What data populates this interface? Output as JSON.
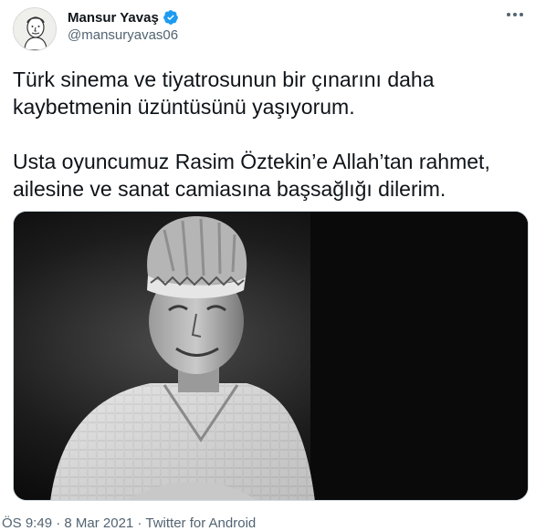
{
  "author": {
    "display_name": "Mansur Yavaş",
    "handle": "@mansuryavas06",
    "verified": true,
    "avatar_icon": "caricature-portrait",
    "verified_icon": "verified-badge-icon",
    "verified_color": "#1d9bf0"
  },
  "tweet": {
    "paragraph1_line1": "Türk sinema ve tiyatrosunun bir çınarını daha",
    "paragraph1_line2": "kaybetmenin üzüntüsünü yaşıyorum.",
    "paragraph2_line1": "Usta oyuncumuz Rasim Öztekin’e Allah’tan rahmet,",
    "paragraph2_line2": "ailesine ve sanat camiasına başsağlığı dilerim."
  },
  "media": {
    "kind": "black-and-white photo of a smiling man wearing a traditional cap"
  },
  "meta": {
    "time": "ÖS 9:49",
    "separator": "·",
    "date": "8 Mar 2021",
    "source": "Twitter for Android"
  },
  "more_icon": "more-horizontal-icon",
  "colors": {
    "text": "#0f1419",
    "secondary": "#536471",
    "border": "#cfd9de"
  }
}
